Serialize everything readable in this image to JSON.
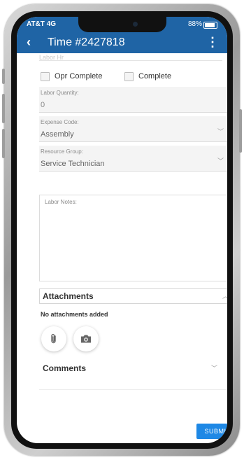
{
  "status_bar": {
    "carrier": "AT&T 4G",
    "battery": "88%"
  },
  "app_bar": {
    "title": "Time #2427818"
  },
  "form": {
    "cut_off_label": "Labor Hr",
    "opr_complete_label": "Opr Complete",
    "complete_label": "Complete",
    "labor_quantity": {
      "label": "Labor Quantity:",
      "value": "0"
    },
    "expense_code": {
      "label": "Expense Code:",
      "value": "Assembly"
    },
    "resource_group": {
      "label": "Resource Group:",
      "value": "Service Technician"
    },
    "labor_notes": {
      "label": "Labor Notes:"
    }
  },
  "attachments": {
    "title": "Attachments",
    "empty_text": "No attachments added"
  },
  "comments": {
    "title": "Comments"
  },
  "actions": {
    "submit_label": "SUBMIT"
  },
  "colors": {
    "header": "#1f64a5",
    "submit": "#1e88e5"
  }
}
